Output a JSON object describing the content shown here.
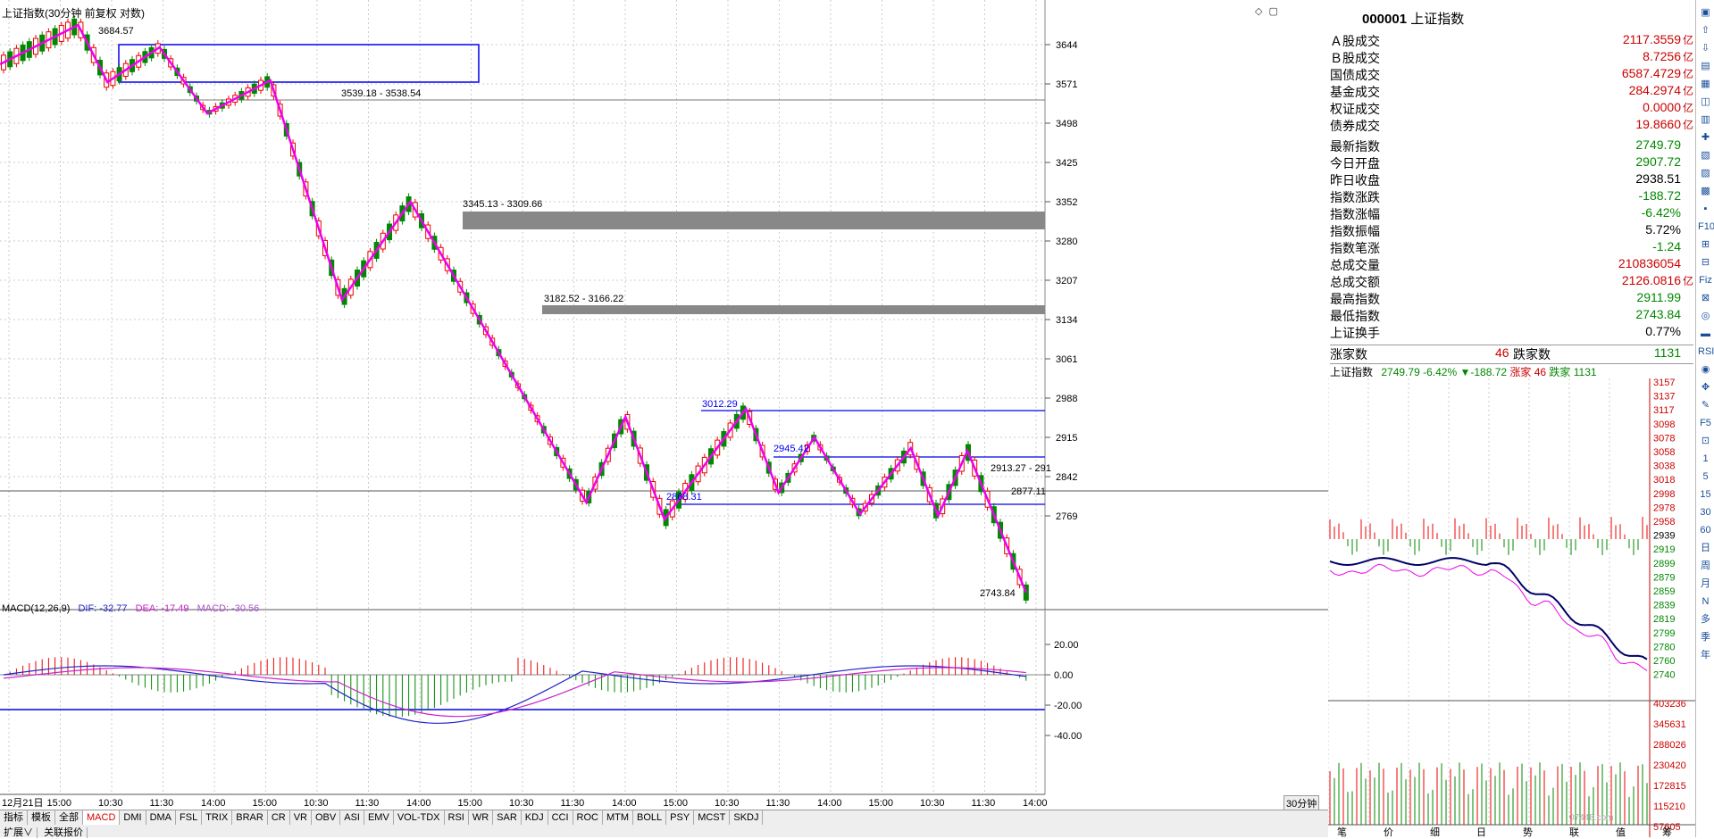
{
  "app": {
    "chart_title": "上证指数(30分钟 前复权 对数)",
    "tools": "◇ ▢",
    "period_tab": "30分钟",
    "watermark": "07448.com"
  },
  "price_axis": {
    "ticks": [
      "3644",
      "3571",
      "3498",
      "3425",
      "3352",
      "3280",
      "3207",
      "3134",
      "3061",
      "2988",
      "2915",
      "2842",
      "2769"
    ]
  },
  "macd_axis": {
    "ticks": [
      "20.00",
      "0.00",
      "-20.00",
      "-40.00"
    ]
  },
  "macd_legend": {
    "name": "MACD(12,26,9)",
    "dif": "DIF: -32.77",
    "dea": "DEA: -17.49",
    "macd": "MACD: -30.56",
    "colors": {
      "dif": "#2222cc",
      "dea": "#cc22cc",
      "macd": "#aa55cc"
    }
  },
  "time_axis": {
    "labels": [
      "12月21日",
      "15:00",
      "10:30",
      "11:30",
      "14:00",
      "15:00",
      "10:30",
      "11:30",
      "14:00",
      "15:00",
      "10:30",
      "11:30",
      "14:00",
      "15:00",
      "10:30",
      "11:30",
      "14:00",
      "15:00",
      "10:30",
      "11:30",
      "14:00"
    ]
  },
  "annotations": {
    "high": "3684.57",
    "zone1": "3539.18 - 3538.54",
    "zone2": "3345.13 - 3309.66",
    "zone3": "3182.52 - 3166.22",
    "a1": "3012.29",
    "a2": "2945.42",
    "a3": "2868.31",
    "a4": "2913.27 - 291",
    "a5": "2877.11",
    "low": "2743.84"
  },
  "bottom_tabs": [
    "指标",
    "模板",
    "全部",
    "MACD",
    "DMI",
    "DMA",
    "FSL",
    "TRIX",
    "BRAR",
    "CR",
    "VR",
    "OBV",
    "ASI",
    "EMV",
    "VOL-TDX",
    "RSI",
    "WR",
    "SAR",
    "KDJ",
    "CCI",
    "ROC",
    "MTM",
    "BOLL",
    "PSY",
    "MCST",
    "SKDJ"
  ],
  "bottom_row2": [
    "扩展∨",
    "关联报价"
  ],
  "info": {
    "code": "000001",
    "name": "上证指数",
    "rows": [
      {
        "label": "Ａ股成交",
        "value": "2117.3559",
        "unit": "亿",
        "color": "#cc0000"
      },
      {
        "label": "Ｂ股成交",
        "value": "8.7256",
        "unit": "亿",
        "color": "#cc0000"
      },
      {
        "label": "国债成交",
        "value": "6587.4729",
        "unit": "亿",
        "color": "#cc0000"
      },
      {
        "label": "基金成交",
        "value": "284.2974",
        "unit": "亿",
        "color": "#cc0000"
      },
      {
        "label": "权证成交",
        "value": "0.0000",
        "unit": "亿",
        "color": "#cc0000"
      },
      {
        "label": "债券成交",
        "value": "19.8660",
        "unit": "亿",
        "color": "#cc0000"
      },
      {
        "label": "最新指数",
        "value": "2749.79",
        "unit": "",
        "color": "#008800"
      },
      {
        "label": "今日开盘",
        "value": "2907.72",
        "unit": "",
        "color": "#008800"
      },
      {
        "label": "昨日收盘",
        "value": "2938.51",
        "unit": "",
        "color": "#000000"
      },
      {
        "label": "指数涨跌",
        "value": "-188.72",
        "unit": "",
        "color": "#008800"
      },
      {
        "label": "指数涨幅",
        "value": "-6.42%",
        "unit": "",
        "color": "#008800"
      },
      {
        "label": "指数振幅",
        "value": "5.72%",
        "unit": "",
        "color": "#000000"
      },
      {
        "label": "指数笔涨",
        "value": "-1.24",
        "unit": "",
        "color": "#008800"
      },
      {
        "label": "总成交量",
        "value": "210836054",
        "unit": "",
        "color": "#cc0000"
      },
      {
        "label": "总成交额",
        "value": "2126.0816",
        "unit": "亿",
        "color": "#cc0000"
      },
      {
        "label": "最高指数",
        "value": "2911.99",
        "unit": "",
        "color": "#008800"
      },
      {
        "label": "最低指数",
        "value": "2743.84",
        "unit": "",
        "color": "#008800"
      },
      {
        "label": "上证换手",
        "value": "0.77%",
        "unit": "",
        "color": "#000000"
      }
    ],
    "up_label": "涨家数",
    "up_value": "46",
    "down_label": "跌家数",
    "down_value": "1131"
  },
  "mini_chart": {
    "header_name": "上证指数",
    "header_price": "2749.79",
    "header_pct": "-6.42%",
    "header_change": "▼-188.72",
    "header_up": "涨家 46",
    "header_down": "跌家 1131",
    "price_ticks": [
      "3157",
      "3137",
      "3117",
      "3098",
      "3078",
      "3058",
      "3038",
      "3018",
      "2998",
      "2978",
      "2958",
      "2939",
      "2919",
      "2899",
      "2879",
      "2859",
      "2839",
      "2819",
      "2799",
      "2780",
      "2760",
      "2740"
    ],
    "vol_ticks": [
      "403236",
      "345631",
      "288026",
      "230420",
      "172815",
      "115210",
      "57605"
    ],
    "bottom_labels": [
      "笔",
      "价",
      "细",
      "日",
      "势",
      "联",
      "值",
      "筹"
    ]
  },
  "right_icons": [
    "▣",
    "⇧",
    "⇩",
    "▤",
    "▦",
    "◫",
    "▥",
    "✚",
    "▧",
    "▨",
    "▩",
    "▪",
    "F10",
    "⊞",
    "⊟",
    "Fiz",
    "⊠",
    "◎",
    "▬",
    "RSI",
    "◉",
    "✥",
    "✎",
    "F5",
    "⊡",
    "1",
    "5",
    "15",
    "30",
    "60",
    "日",
    "周",
    "月",
    "N",
    "多",
    "季",
    "年"
  ]
}
